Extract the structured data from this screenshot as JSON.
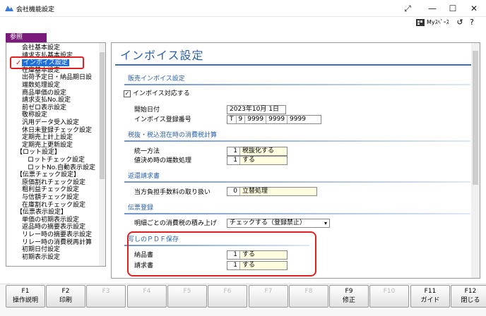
{
  "window": {
    "title": "会社機能設定"
  },
  "toolbar": {
    "myspace_label": "Myｽﾍﾟｰｽ"
  },
  "ref_tab": "参照",
  "tree": [
    {
      "label": "会社基本設定",
      "indent": 1
    },
    {
      "label": "請求支払基本設定",
      "indent": 1
    },
    {
      "label": "インボイス設定",
      "indent": 1,
      "selected": true
    },
    {
      "label": "在庫基本設定",
      "indent": 1
    },
    {
      "label": "出荷予定日・納品期日設",
      "indent": 1
    },
    {
      "label": "端数処理設定",
      "indent": 1
    },
    {
      "label": "商品単価の設定",
      "indent": 1
    },
    {
      "label": "請求支払No.設定",
      "indent": 1
    },
    {
      "label": "前ゼロ表示設定",
      "indent": 1
    },
    {
      "label": "敬称設定",
      "indent": 1
    },
    {
      "label": "汎用データ受入設定",
      "indent": 1
    },
    {
      "label": "休日未登録チェック設定",
      "indent": 1
    },
    {
      "label": "定期売上計上設定",
      "indent": 1
    },
    {
      "label": "定期売上更新設定",
      "indent": 1
    },
    {
      "label": "【ロット設定】",
      "indent": 0
    },
    {
      "label": "ロットチェック設定",
      "indent": 2
    },
    {
      "label": "ロットNo.自動表示設定",
      "indent": 2
    },
    {
      "label": "【伝票チェック設定】",
      "indent": 0
    },
    {
      "label": "原価割れチェック設定",
      "indent": 1
    },
    {
      "label": "粗利益チェック設定",
      "indent": 1
    },
    {
      "label": "与信額チェック設定",
      "indent": 1
    },
    {
      "label": "在庫割れチェック設定",
      "indent": 1
    },
    {
      "label": "【伝票表示設定】",
      "indent": 0
    },
    {
      "label": "単価の初期表示設定",
      "indent": 1
    },
    {
      "label": "返品時の摘要表示設定",
      "indent": 1
    },
    {
      "label": "リレー時の摘要表示設定",
      "indent": 1
    },
    {
      "label": "リレー時の消費税再計算",
      "indent": 1
    },
    {
      "label": "初期日付設定",
      "indent": 1
    },
    {
      "label": "初期表示設定",
      "indent": 1
    }
  ],
  "main": {
    "title": "インボイス設定",
    "sections": {
      "sales_invoice": "販売インボイス設定",
      "tax_mixed": "税抜・税込混在時の消費税計算",
      "return_invoice": "返還請求書",
      "slip_entry": "伝票登録",
      "copy_pdf": "写しのＰＤＦ保存"
    },
    "invoice_support_label": "インボイス対応する",
    "start_date_label": "開始日付",
    "start_date_value": "2023年10月 1日",
    "reg_number_label": "インボイス登録番号",
    "reg_number_parts": [
      "T",
      "9",
      "9999",
      "9999",
      "9999"
    ],
    "unified_label": "統一方法",
    "unified_num": "1",
    "unified_text": "税抜化する",
    "rounding_label": "値決め時の端数処理",
    "rounding_num": "1",
    "rounding_text": "する",
    "fee_label": "当方負担手数料の取り扱い",
    "fee_num": "0",
    "fee_text": "立替処理",
    "detail_tax_label": "明細ごとの消費税の積み上げ",
    "detail_tax_value": "チェックする（登録禁止）",
    "delivery_label": "納品書",
    "delivery_num": "1",
    "delivery_text": "する",
    "invoice_label": "請求書",
    "invoice_num": "1",
    "invoice_text": "する"
  },
  "fkeys": [
    {
      "key": "F1",
      "label": "操作説明",
      "enabled": true
    },
    {
      "key": "F2",
      "label": "印刷",
      "enabled": true
    },
    {
      "key": "F3",
      "label": "",
      "enabled": false
    },
    {
      "key": "F4",
      "label": "",
      "enabled": false
    },
    {
      "key": "F5",
      "label": "",
      "enabled": false
    },
    {
      "key": "F6",
      "label": "",
      "enabled": false
    },
    {
      "key": "F7",
      "label": "",
      "enabled": false
    },
    {
      "key": "F8",
      "label": "",
      "enabled": false
    },
    {
      "key": "F9",
      "label": "修正",
      "enabled": true
    },
    {
      "key": "F10",
      "label": "",
      "enabled": false
    },
    {
      "key": "F11",
      "label": "ガイド",
      "enabled": true
    },
    {
      "key": "F12",
      "label": "閉じる",
      "enabled": true
    }
  ]
}
